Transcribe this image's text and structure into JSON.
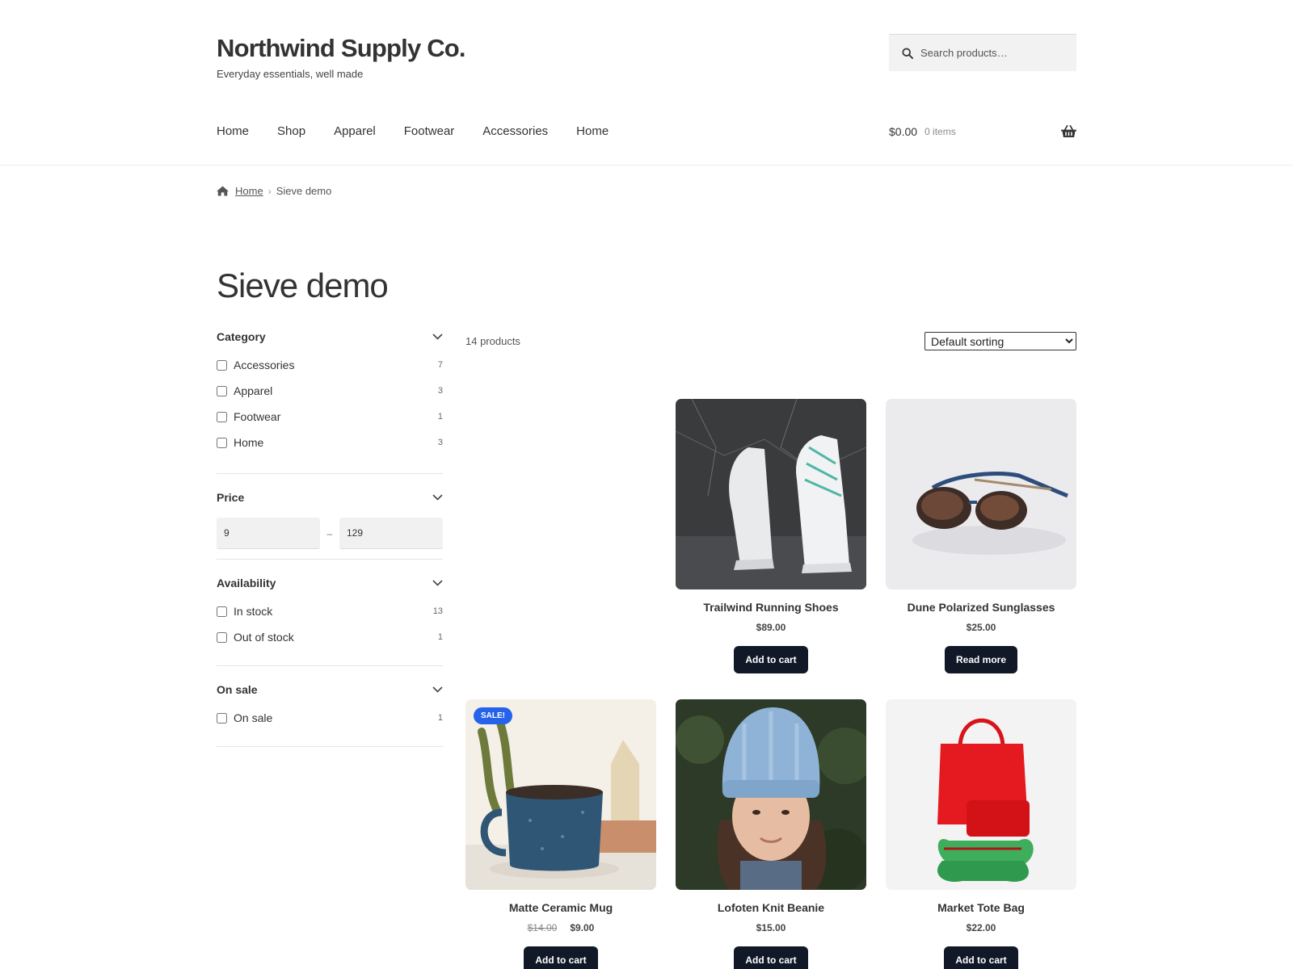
{
  "header": {
    "site_title": "Northwind Supply Co.",
    "tagline": "Everyday essentials, well made",
    "search_placeholder": "Search products…",
    "nav": [
      "Home",
      "Shop",
      "Apparel",
      "Footwear",
      "Accessories",
      "Home"
    ],
    "cart_amount": "$0.00",
    "cart_count": "0 items"
  },
  "breadcrumb": {
    "home": "Home",
    "separator": "›",
    "current": "Sieve demo"
  },
  "page_title": "Sieve demo",
  "filters": {
    "category": {
      "title": "Category",
      "options": [
        {
          "label": "Accessories",
          "count": "7"
        },
        {
          "label": "Apparel",
          "count": "3"
        },
        {
          "label": "Footwear",
          "count": "1"
        },
        {
          "label": "Home",
          "count": "3"
        }
      ]
    },
    "price": {
      "title": "Price",
      "min": "9",
      "max": "129",
      "separator": "–"
    },
    "availability": {
      "title": "Availability",
      "options": [
        {
          "label": "In stock",
          "count": "13"
        },
        {
          "label": "Out of stock",
          "count": "1"
        }
      ]
    },
    "on_sale": {
      "title": "On sale",
      "options": [
        {
          "label": "On sale",
          "count": "1"
        }
      ]
    }
  },
  "toolbar": {
    "count": "14 products",
    "sort_selected": "Default sorting"
  },
  "products": [
    {
      "name": "Trailwind Running Shoes",
      "price": "$89.00",
      "button": "Add to cart",
      "image": "running-shoes-image"
    },
    {
      "name": "Dune Polarized Sunglasses",
      "price": "$25.00",
      "button": "Read more",
      "image": "sunglasses-image"
    },
    {
      "name": "Matte Ceramic Mug",
      "old_price": "$14.00",
      "price": "$9.00",
      "button": "Add to cart",
      "badge": "SALE!",
      "image": "ceramic-mug-image"
    },
    {
      "name": "Lofoten Knit Beanie",
      "price": "$15.00",
      "button": "Add to cart",
      "image": "knit-beanie-image"
    },
    {
      "name": "Market Tote Bag",
      "price": "$22.00",
      "button": "Add to cart",
      "image": "tote-bag-image"
    }
  ],
  "colors": {
    "button": "#111827",
    "sale_badge": "#2563eb",
    "search_bg": "#f2f2f2"
  }
}
